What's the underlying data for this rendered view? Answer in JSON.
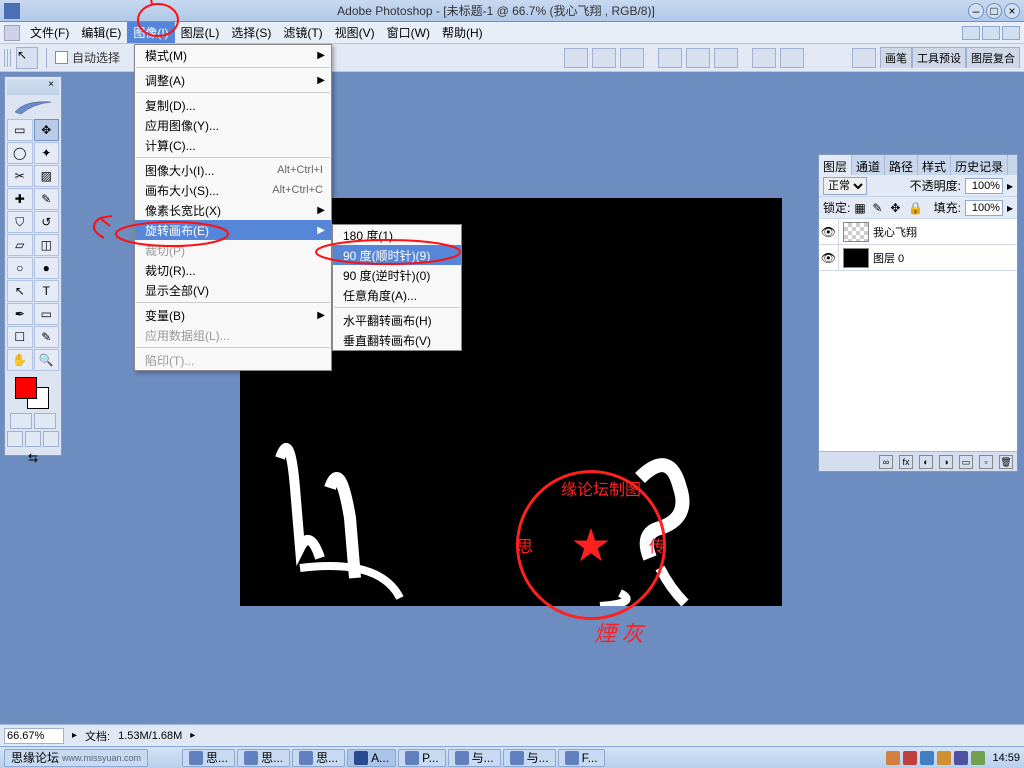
{
  "title": "Adobe Photoshop - [未标题-1 @ 66.7% (我心飞翔 , RGB/8)]",
  "menubar": {
    "items": [
      "文件(F)",
      "编辑(E)",
      "图像(I)",
      "图层(L)",
      "选择(S)",
      "滤镜(T)",
      "视图(V)",
      "窗口(W)",
      "帮助(H)"
    ],
    "active_index": 2
  },
  "optionsbar": {
    "auto_select_label": "自动选择",
    "right_tabs": [
      "画笔",
      "工具预设",
      "图层复合"
    ]
  },
  "image_menu": {
    "items": [
      {
        "label": "模式(M)",
        "sub": true
      },
      {
        "sep": true
      },
      {
        "label": "调整(A)",
        "sub": true
      },
      {
        "sep": true
      },
      {
        "label": "复制(D)..."
      },
      {
        "label": "应用图像(Y)..."
      },
      {
        "label": "计算(C)..."
      },
      {
        "sep": true
      },
      {
        "label": "图像大小(I)...",
        "accel": "Alt+Ctrl+I"
      },
      {
        "label": "画布大小(S)...",
        "accel": "Alt+Ctrl+C"
      },
      {
        "label": "像素长宽比(X)",
        "sub": true
      },
      {
        "label": "旋转画布(E)",
        "sub": true,
        "hi": true
      },
      {
        "label": "裁切(P)",
        "dis": true
      },
      {
        "label": "裁切(R)..."
      },
      {
        "label": "显示全部(V)"
      },
      {
        "sep": true
      },
      {
        "label": "变量(B)",
        "sub": true
      },
      {
        "label": "应用数据组(L)...",
        "dis": true
      },
      {
        "sep": true
      },
      {
        "label": "陷印(T)...",
        "dis": true
      }
    ]
  },
  "rotate_submenu": {
    "items": [
      {
        "label": "180 度(1)"
      },
      {
        "label": "90 度(顺时针)(9)",
        "hi": true
      },
      {
        "label": "90 度(逆时针)(0)"
      },
      {
        "label": "任意角度(A)..."
      },
      {
        "sep": true
      },
      {
        "label": "水平翻转画布(H)"
      },
      {
        "label": "垂直翻转画布(V)"
      }
    ]
  },
  "layers_panel": {
    "tabs": [
      "图层",
      "通道",
      "路径",
      "样式",
      "历史记录"
    ],
    "active_tab": 0,
    "blend_mode": "正常",
    "opacity_label": "不透明度:",
    "opacity": "100%",
    "lock_label": "锁定:",
    "fill_label": "填充:",
    "fill": "100%",
    "layers": [
      {
        "name": "我心飞翔",
        "thumb": "checker"
      },
      {
        "name": "图层 0",
        "thumb": "black"
      }
    ]
  },
  "statusbar": {
    "zoom": "66.67%",
    "doc_label": "文档:",
    "doc_size": "1.53M/1.68M"
  },
  "taskbar": {
    "items": [
      {
        "label": "思缘论坛",
        "url_text": "www.missyuan.com"
      },
      {
        "label": "思..."
      },
      {
        "label": "思..."
      },
      {
        "label": "思..."
      },
      {
        "label": "A...",
        "active": true
      },
      {
        "label": "P..."
      },
      {
        "label": "与..."
      },
      {
        "label": "与..."
      },
      {
        "label": "F..."
      }
    ],
    "clock": "14:59"
  },
  "stamp": {
    "arc_text": "缘论坛制图",
    "arc_left": "思",
    "arc_right": "传",
    "sig": "煙 灰"
  },
  "colors": {
    "fg": "#ff0000",
    "bg": "#ffffff",
    "highlight": "#5586d8",
    "annot": "#ff1010"
  }
}
